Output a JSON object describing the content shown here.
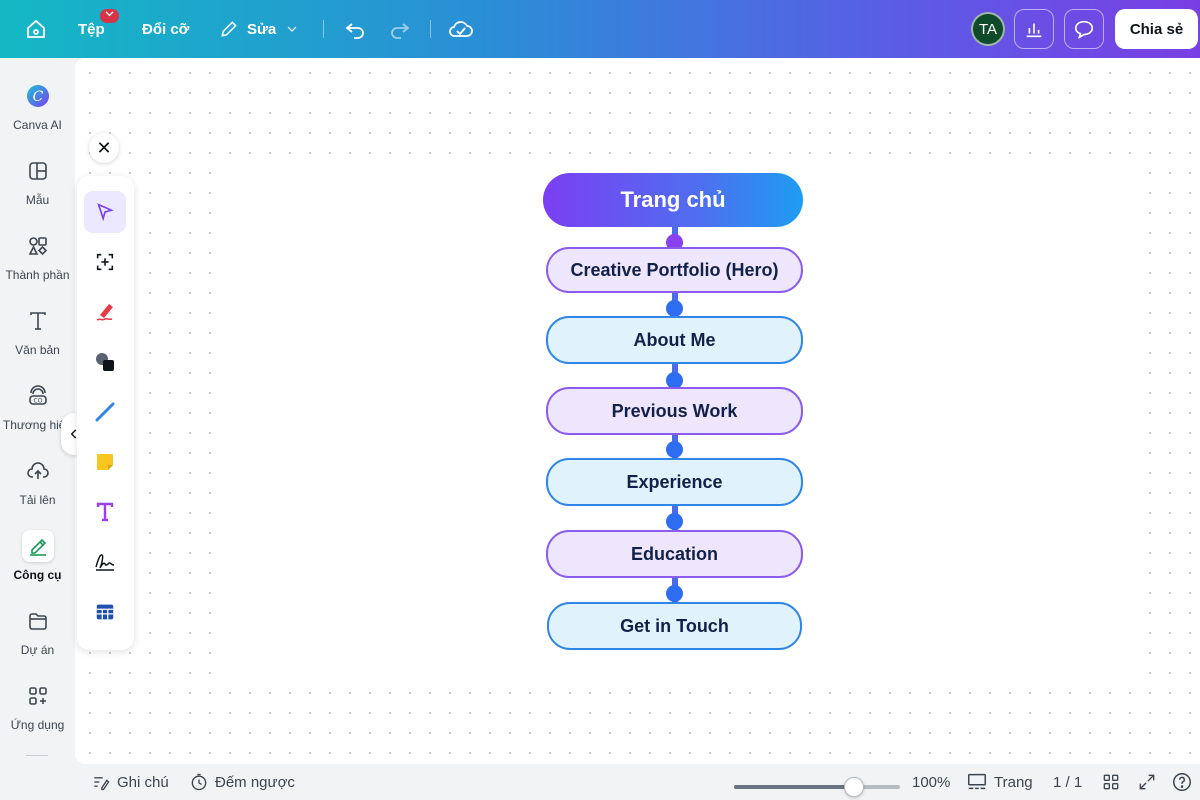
{
  "topbar": {
    "file_label": "Tệp",
    "file_badge": "",
    "resize_label": "Đổi cỡ",
    "edit_label": "Sửa",
    "avatar_initials": "TA",
    "share_label": "Chia sẻ"
  },
  "sidebar": {
    "items": [
      {
        "label": "Canva AI",
        "icon": "canva-ai-icon"
      },
      {
        "label": "Mẫu",
        "icon": "template-icon"
      },
      {
        "label": "Thành phần",
        "icon": "elements-icon"
      },
      {
        "label": "Văn bản",
        "icon": "text-icon"
      },
      {
        "label": "Thương hiệu",
        "icon": "brand-icon"
      },
      {
        "label": "Tải lên",
        "icon": "upload-icon"
      },
      {
        "label": "Công cụ",
        "icon": "tools-icon",
        "active": true
      },
      {
        "label": "Dự án",
        "icon": "folder-icon"
      },
      {
        "label": "Ứng dụng",
        "icon": "apps-icon"
      }
    ]
  },
  "palette": {
    "tools": [
      "select-tool",
      "frame-tool",
      "draw-tool",
      "shapes-tool",
      "line-tool",
      "sticky-note-tool",
      "text-tool",
      "signature-tool",
      "table-tool"
    ]
  },
  "flowchart": {
    "title": "Trang chủ",
    "nodes": [
      {
        "label": "Creative Portfolio (Hero)",
        "style": "purple"
      },
      {
        "label": "About Me",
        "style": "blue"
      },
      {
        "label": "Previous Work",
        "style": "purple"
      },
      {
        "label": "Experience",
        "style": "blue"
      },
      {
        "label": "Education",
        "style": "purple"
      },
      {
        "label": "Get in Touch",
        "style": "blue"
      }
    ]
  },
  "bottombar": {
    "notes_label": "Ghi chú",
    "timer_label": "Đếm ngược",
    "zoom_value": "100%",
    "zoom_fraction": 0.72,
    "pages_label": "Trang",
    "page_count": "1 / 1"
  },
  "colors": {
    "purple_border": "#8a5cf0",
    "blue_border": "#2f86e8",
    "accent": "#7b3ff2"
  }
}
